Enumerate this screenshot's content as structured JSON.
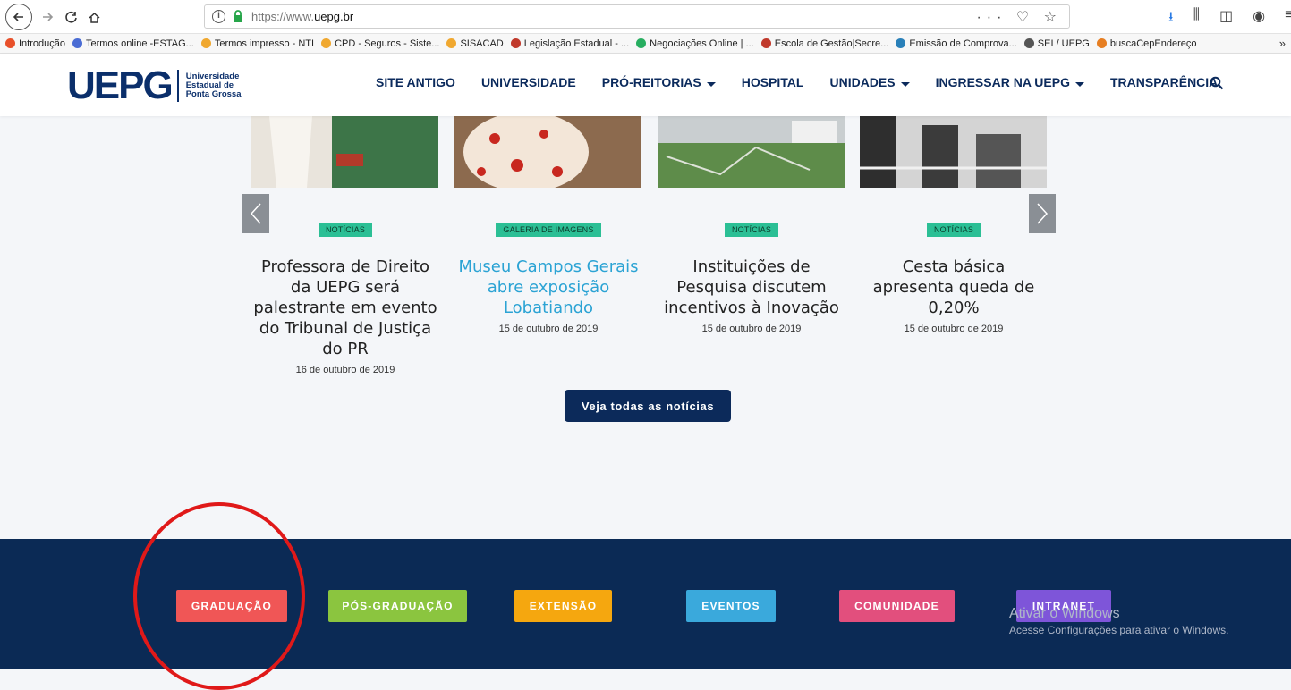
{
  "browser": {
    "url_plain": "https://www.",
    "url_host": "uepg.br",
    "url_actions": "··· ♡ ☆",
    "bookmarks": [
      {
        "label": "Introdução",
        "color": "#e8502a"
      },
      {
        "label": "Termos online -ESTAG...",
        "color": "#4a6cd4"
      },
      {
        "label": "Termos impresso - NTI",
        "color": "#f0a830"
      },
      {
        "label": "CPD - Seguros - Siste...",
        "color": "#f0a830"
      },
      {
        "label": "SISACAD",
        "color": "#f0a830"
      },
      {
        "label": "Legislação Estadual - ...",
        "color": "#c0392b"
      },
      {
        "label": "Negociações Online | ...",
        "color": "#27ae60"
      },
      {
        "label": "Escola de Gestão|Secre...",
        "color": "#c0392b"
      },
      {
        "label": "Emissão de Comprova...",
        "color": "#2980b9"
      },
      {
        "label": "SEI / UEPG",
        "color": "#555555"
      },
      {
        "label": "buscaCepEndereço",
        "color": "#e67e22"
      }
    ],
    "more": "»"
  },
  "site": {
    "logo_mark": "UEPG",
    "logo_text": [
      "Universidade",
      "Estadual de",
      "Ponta Grossa"
    ],
    "nav": [
      {
        "label": "SITE ANTIGO",
        "dropdown": false
      },
      {
        "label": "UNIVERSIDADE",
        "dropdown": false
      },
      {
        "label": "PRÓ-REITORIAS",
        "dropdown": true
      },
      {
        "label": "HOSPITAL",
        "dropdown": false
      },
      {
        "label": "UNIDADES",
        "dropdown": true
      },
      {
        "label": "INGRESSAR NA UEPG",
        "dropdown": true
      },
      {
        "label": "TRANSPARÊNCIA",
        "dropdown": false
      }
    ]
  },
  "news": {
    "cards": [
      {
        "category": "NOTÍCIAS",
        "title": "Professora de Direito da UEPG será palestrante em evento do Tribunal de Justiça do PR",
        "date": "16 de outubro de 2019",
        "link": false
      },
      {
        "category": "GALERIA DE IMAGENS",
        "title": "Museu Campos Gerais abre exposição Lobatiando",
        "date": "15 de outubro de 2019",
        "link": true
      },
      {
        "category": "NOTÍCIAS",
        "title": "Instituições de Pesquisa discutem incentivos à Inovação",
        "date": "15 de outubro de 2019",
        "link": false
      },
      {
        "category": "NOTÍCIAS",
        "title": "Cesta básica apresenta queda de 0,20%",
        "date": "15 de outubro de 2019",
        "link": false
      }
    ],
    "all_label": "Veja todas as notícias"
  },
  "footer": {
    "categories": [
      {
        "label": "GRADUAÇÃO",
        "color": "#f05656"
      },
      {
        "label": "PÓS-GRADUAÇÃO",
        "color": "#8bc53f"
      },
      {
        "label": "EXTENSÃO",
        "color": "#f5a70f"
      },
      {
        "label": "EVENTOS",
        "color": "#3aa9dc"
      },
      {
        "label": "COMUNIDADE",
        "color": "#e24f7d"
      },
      {
        "label": "INTRANET",
        "color": "#7e55d9"
      }
    ],
    "watermark_title": "Ativar o Windows",
    "watermark_sub": "Acesse Configurações para ativar o Windows."
  }
}
